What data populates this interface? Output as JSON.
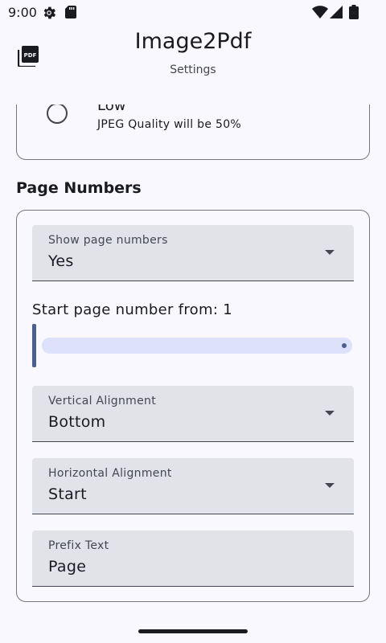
{
  "status_bar": {
    "time": "9:00",
    "icons": [
      "gear-icon",
      "sd-card-icon",
      "wifi-icon",
      "signal-icon",
      "battery-icon"
    ]
  },
  "app_bar": {
    "title": "Image2Pdf",
    "subtitle": "Settings",
    "icon": "pdf-icon"
  },
  "image_quality": {
    "option_label": "Low",
    "option_description": "JPEG Quality will be 50%",
    "selected": false
  },
  "page_numbers": {
    "section_title": "Page Numbers",
    "show_page_numbers": {
      "label": "Show page numbers",
      "value": "Yes"
    },
    "start_from": {
      "label": "Start page number from: 1",
      "value": 1
    },
    "vertical_alignment": {
      "label": "Vertical Alignment",
      "value": "Bottom"
    },
    "horizontal_alignment": {
      "label": "Horizontal Alignment",
      "value": "Start"
    },
    "prefix_text": {
      "label": "Prefix Text",
      "value": "Page"
    }
  },
  "colors": {
    "background": "#f8f8fe",
    "field_background": "#e2e2e9",
    "accent": "#4c5d92",
    "track": "#dde1f9"
  }
}
